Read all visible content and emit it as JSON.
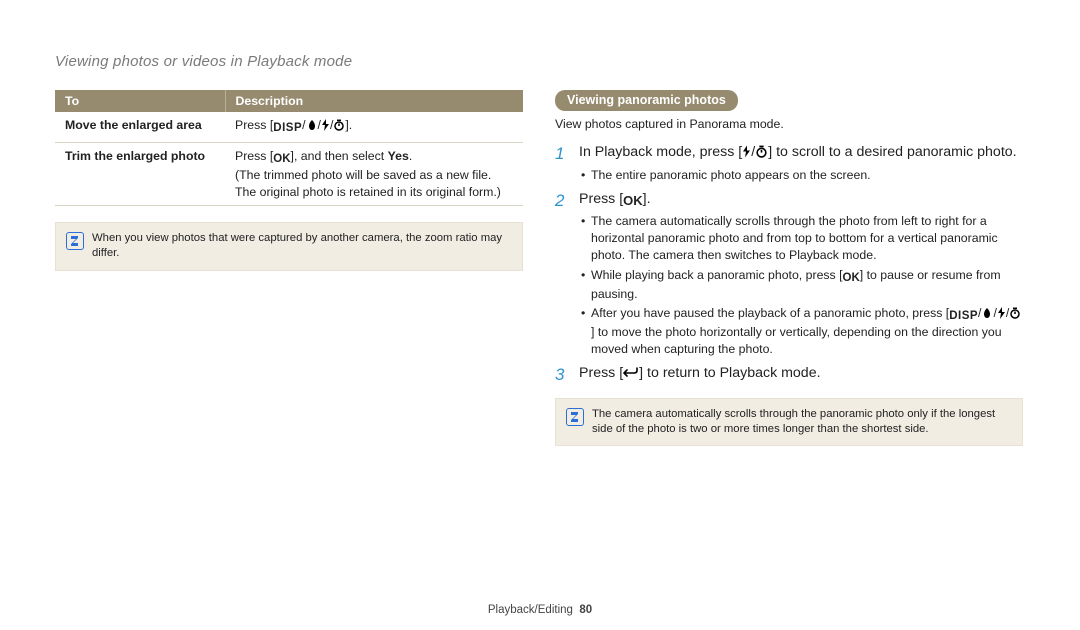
{
  "pageTitle": "Viewing photos or videos in Playback mode",
  "tableHeader": {
    "c0": "To",
    "c1": "Description"
  },
  "row0": {
    "c0": "Move the enlarged area",
    "c1_pre": "Press [",
    "c1_disp": "DISP",
    "c1_post": "]."
  },
  "row1": {
    "c0": "Trim the enlarged photo",
    "c1_a_pre": "Press [",
    "c1_a_ok": "OK",
    "c1_a_mid": "], and then select ",
    "c1_a_yes": "Yes",
    "c1_a_post": ".",
    "c1_b": "(The trimmed photo will be saved as a new file. The original photo is retained in its original form.)"
  },
  "noteLeft": "When you view photos that were captured by another camera, the zoom ratio may differ.",
  "pillLabel": "Viewing panoramic photos",
  "intro": "View photos captured in Panorama mode.",
  "step1": {
    "num": "1",
    "main_pre": "In Playback mode, press [",
    "main_post": "] to scroll to a desired panoramic photo.",
    "sub1": "The entire panoramic photo appears on the screen."
  },
  "step2": {
    "num": "2",
    "main_pre": "Press [",
    "main_ok": "OK",
    "main_post": "].",
    "sub1": "The camera automatically scrolls through the photo from left to right for a horizontal panoramic photo and from top to bottom for a vertical panoramic photo. The camera then switches to Playback mode.",
    "sub2_pre": "While playing back a panoramic photo, press [",
    "sub2_ok": "OK",
    "sub2_post": "] to pause or resume from pausing.",
    "sub3_pre": "After you have paused the playback of a panoramic photo, press [",
    "sub3_disp": "DISP",
    "sub3_post": "] to move the photo horizontally or vertically, depending on the direction you moved when capturing the photo."
  },
  "step3": {
    "num": "3",
    "main_pre": "Press [",
    "main_post": "] to return to Playback mode."
  },
  "noteRight": "The camera automatically scrolls through the panoramic photo only if the longest side of the photo is two or more times longer than the shortest side.",
  "footerSection": "Playback/Editing",
  "footerPage": "80"
}
